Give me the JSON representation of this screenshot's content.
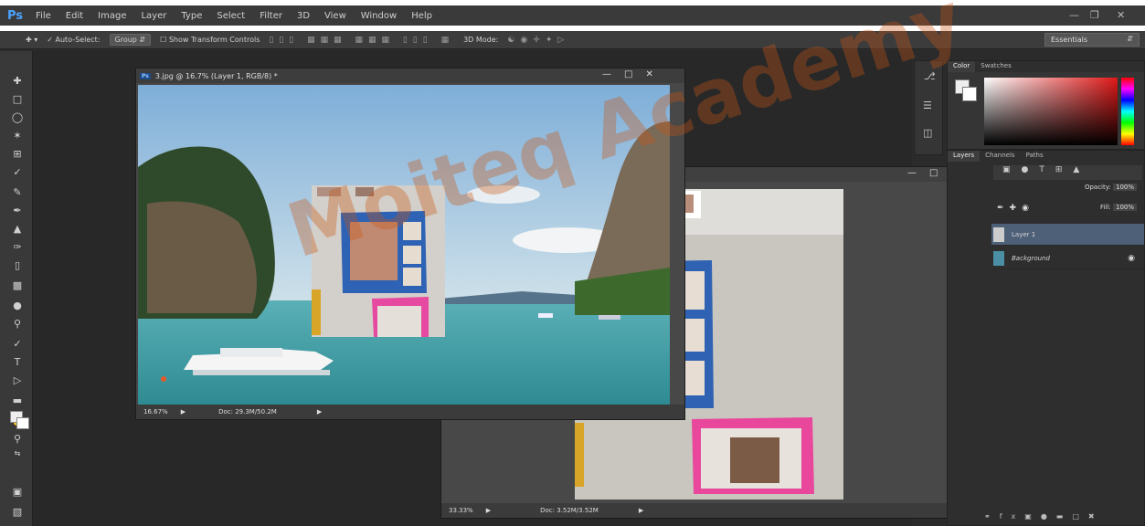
{
  "app": {
    "logo": "Ps"
  },
  "menu": [
    "File",
    "Edit",
    "Image",
    "Layer",
    "Type",
    "Select",
    "Filter",
    "3D",
    "View",
    "Window",
    "Help"
  ],
  "options_bar": {
    "auto_select": "Auto-Select:",
    "group": "Group",
    "show_transform": "Show Transform Controls",
    "mode_3d": "3D Mode:",
    "workspace": "Essentials"
  },
  "doc1": {
    "title": "3.jpg @ 16.7% (Layer 1, RGB/8) *",
    "zoom": "16.67%",
    "doc_size": "Doc: 29.3M/50.2M"
  },
  "doc2": {
    "zoom": "33.33%",
    "doc_size": "Doc: 3.52M/3.52M"
  },
  "color_panel": {
    "tabs": [
      "Color",
      "Swatches"
    ]
  },
  "layers_panel": {
    "tabs": [
      "Layers",
      "Channels",
      "Paths"
    ],
    "opacity_label": "Opacity:",
    "opacity_value": "100%",
    "fill_label": "Fill:",
    "fill_value": "100%",
    "layers": [
      {
        "name": "Layer 1",
        "selected": true
      },
      {
        "name": "Background",
        "locked": true
      }
    ]
  },
  "watermark": "Moiteq Academy"
}
